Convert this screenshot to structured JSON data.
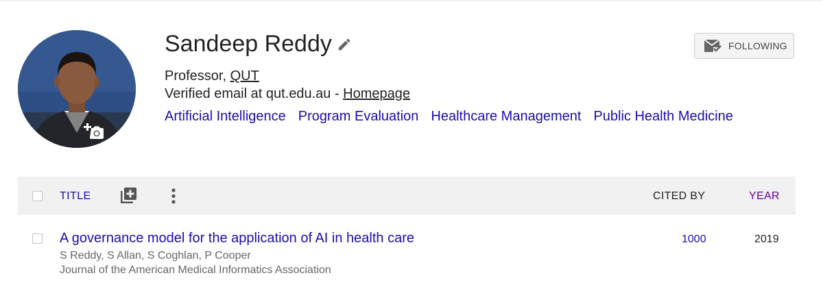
{
  "profile": {
    "name": "Sandeep Reddy",
    "affiliation_prefix": "Professor, ",
    "affiliation_link": "QUT",
    "email_text": "Verified email at qut.edu.au - ",
    "homepage_label": "Homepage",
    "interests": [
      "Artificial Intelligence",
      "Program Evaluation",
      "Healthcare Management",
      "Public Health Medicine"
    ]
  },
  "follow_button": {
    "label": "FOLLOWING"
  },
  "table": {
    "headers": {
      "title": "TITLE",
      "cited_by": "CITED BY",
      "year": "YEAR"
    },
    "rows": [
      {
        "title": "A governance model for the application of AI in health care",
        "authors": "S Reddy, S Allan, S Coghlan, P Cooper",
        "venue": "Journal of the American Medical Informatics Association",
        "cited_by": "1000",
        "year": "2019"
      }
    ]
  },
  "colors": {
    "link": "#1a0dab",
    "year_header": "#660099",
    "header_bg": "#f1f1f1",
    "avatar_bg": "#2e4f86"
  },
  "icons": [
    "camera-add-icon",
    "pencil-icon",
    "mail-check-icon",
    "add-to-list-icon",
    "more-vert-icon"
  ]
}
